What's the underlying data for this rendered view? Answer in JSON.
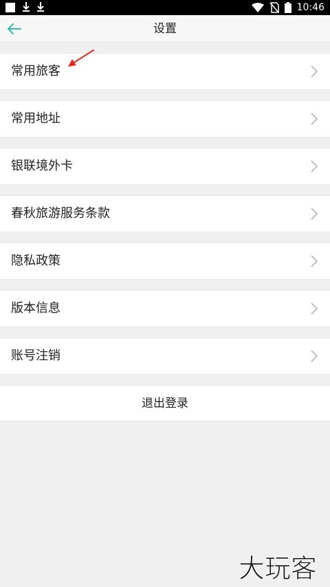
{
  "status_bar": {
    "time": "10:46",
    "icons": [
      "notification-square-icon",
      "download-icon",
      "download-icon",
      "wifi-icon",
      "no-sim-icon",
      "battery-icon"
    ]
  },
  "header": {
    "title": "设置",
    "back_icon": "back-arrow-icon",
    "accent_color": "#2bbfb0"
  },
  "menu": {
    "items": [
      {
        "label": "常用旅客",
        "icon": "chevron-right-icon"
      },
      {
        "label": "常用地址",
        "icon": "chevron-right-icon"
      },
      {
        "label": "银联境外卡",
        "icon": "chevron-right-icon"
      },
      {
        "label": "春秋旅游服务条款",
        "icon": "chevron-right-icon"
      },
      {
        "label": "隐私政策",
        "icon": "chevron-right-icon"
      },
      {
        "label": "版本信息",
        "icon": "chevron-right-icon"
      },
      {
        "label": "账号注销",
        "icon": "chevron-right-icon"
      }
    ]
  },
  "logout": {
    "label": "退出登录"
  },
  "watermark": {
    "text": "大玩客"
  },
  "annotation": {
    "color": "#e8251e",
    "icon": "red-arrow-icon"
  }
}
